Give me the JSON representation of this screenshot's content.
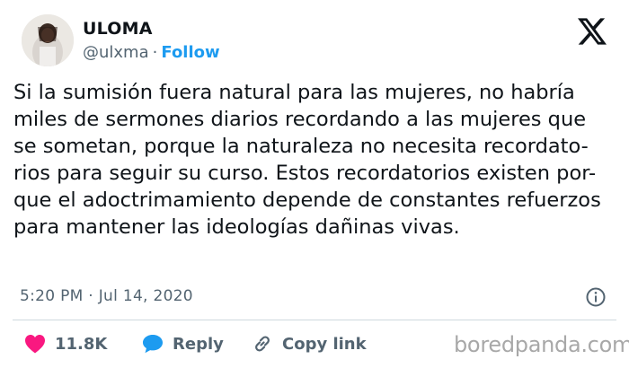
{
  "author": {
    "name": "ULOMA",
    "handle": "@ulxma",
    "separator": "·",
    "follow_label": "Follow"
  },
  "tweet": {
    "text": "Si la sumisión fuera natural para las mujeres, no habría\nmiles de sermones diarios recordando a las mujeres que\nse sometan, porque la naturaleza no necesita recordato-\nrios para seguir su curso. Estos recordatorios existen por-\nque el adoctrimamiento depende de constantes refuerzos\npara mantener las ideologías dañinas vivas.",
    "timestamp": "5:20 PM · Jul 14, 2020"
  },
  "actions": {
    "likes": "11.8K",
    "reply_label": "Reply",
    "copy_link_label": "Copy link"
  },
  "watermark": "boredpanda.com",
  "colors": {
    "like": "#f91880",
    "reply": "#1d9bf0",
    "follow": "#1d9bf0",
    "muted": "#536471"
  },
  "icons": {
    "platform": "x-logo-icon",
    "info": "info-icon",
    "like": "heart-icon",
    "reply": "speech-bubble-icon",
    "copy": "link-icon"
  }
}
